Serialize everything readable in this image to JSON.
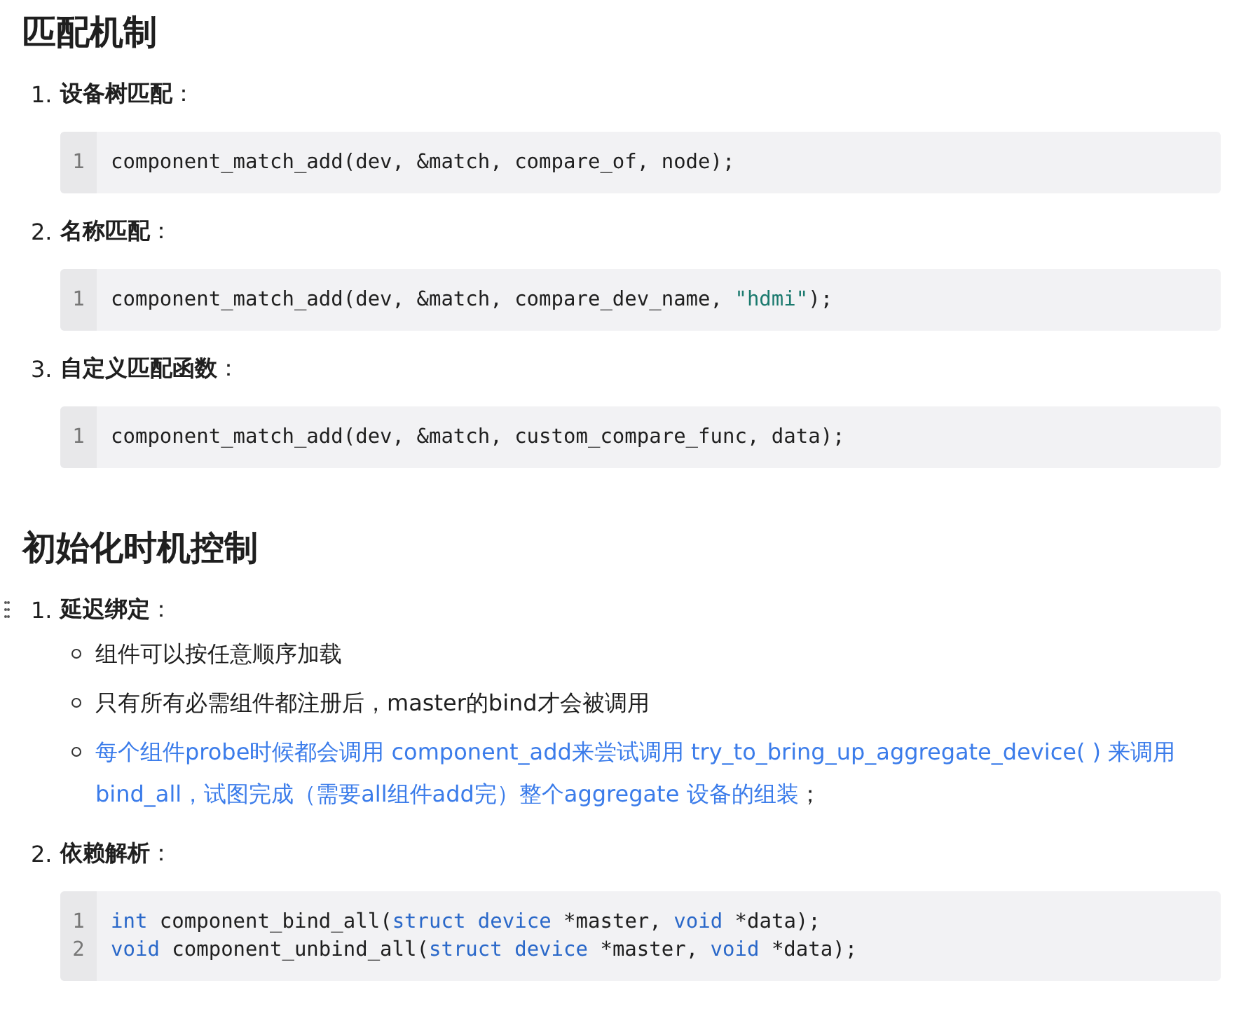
{
  "sections": [
    {
      "heading": "匹配机制",
      "items": [
        {
          "number": "1.",
          "title": "设备树匹配",
          "suffix": "：",
          "code": [
            {
              "number": "1",
              "tokens": [
                {
                  "kind": "plain",
                  "text": "component_match_add(dev, &match, compare_of, node);"
                }
              ]
            }
          ]
        },
        {
          "number": "2.",
          "title": "名称匹配",
          "suffix": "：",
          "code": [
            {
              "number": "1",
              "tokens": [
                {
                  "kind": "plain",
                  "text": "component_match_add(dev, &match, compare_dev_name, "
                },
                {
                  "kind": "string",
                  "text": "\"hdmi\""
                },
                {
                  "kind": "plain",
                  "text": ");"
                }
              ]
            }
          ]
        },
        {
          "number": "3.",
          "title": "自定义匹配函数",
          "suffix": "：",
          "code": [
            {
              "number": "1",
              "tokens": [
                {
                  "kind": "plain",
                  "text": "component_match_add(dev, &match, custom_compare_func, data);"
                }
              ]
            }
          ]
        }
      ]
    },
    {
      "heading": "初始化时机控制",
      "items": [
        {
          "number": "1.",
          "title": "延迟绑定",
          "suffix": "：",
          "handle": true,
          "bullets": [
            {
              "kind": "plain",
              "text": "组件可以按任意顺序加载"
            },
            {
              "kind": "plain",
              "text": "只有所有必需组件都注册后，master的bind才会被调用"
            },
            {
              "kind": "highlight",
              "text": "每个组件probe时候都会调用 component_add来尝试调用 try_to_bring_up_aggregate_device( ) 来调用bind_all，试图完成（需要all组件add完）整个aggregate 设备的组装",
              "tail": "；"
            }
          ]
        },
        {
          "number": "2.",
          "title": "依赖解析",
          "suffix": "：",
          "code": [
            {
              "number": "1",
              "tokens": [
                {
                  "kind": "keyword",
                  "text": "int"
                },
                {
                  "kind": "plain",
                  "text": " component_bind_all("
                },
                {
                  "kind": "keyword",
                  "text": "struct device"
                },
                {
                  "kind": "plain",
                  "text": " *master, "
                },
                {
                  "kind": "keyword",
                  "text": "void"
                },
                {
                  "kind": "plain",
                  "text": " *data);"
                }
              ]
            },
            {
              "number": "2",
              "tokens": [
                {
                  "kind": "keyword",
                  "text": "void"
                },
                {
                  "kind": "plain",
                  "text": " component_unbind_all("
                },
                {
                  "kind": "keyword",
                  "text": "struct device"
                },
                {
                  "kind": "plain",
                  "text": " *master, "
                },
                {
                  "kind": "keyword",
                  "text": "void"
                },
                {
                  "kind": "plain",
                  "text": " *data);"
                }
              ]
            }
          ]
        }
      ]
    }
  ]
}
